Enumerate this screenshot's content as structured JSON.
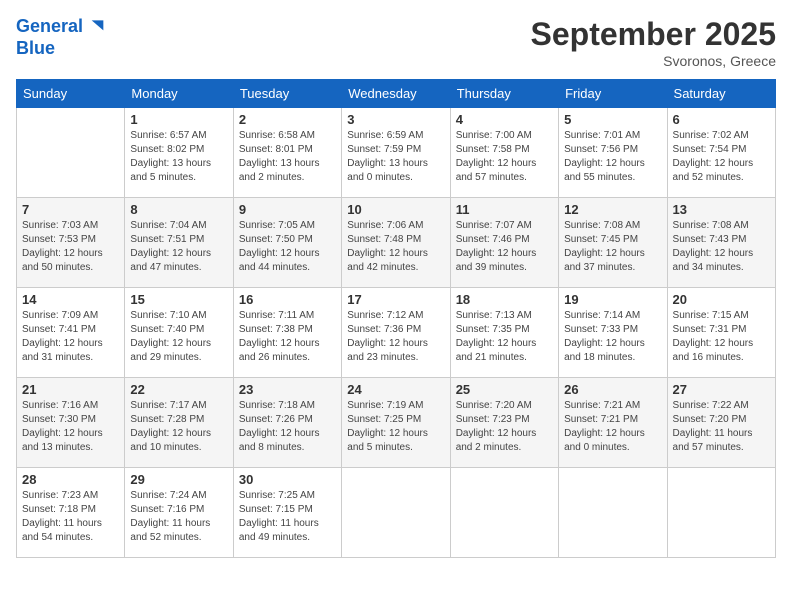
{
  "header": {
    "logo_line1": "General",
    "logo_line2": "Blue",
    "month": "September 2025",
    "location": "Svoronos, Greece"
  },
  "weekdays": [
    "Sunday",
    "Monday",
    "Tuesday",
    "Wednesday",
    "Thursday",
    "Friday",
    "Saturday"
  ],
  "weeks": [
    [
      {
        "day": "",
        "info": ""
      },
      {
        "day": "1",
        "info": "Sunrise: 6:57 AM\nSunset: 8:02 PM\nDaylight: 13 hours\nand 5 minutes."
      },
      {
        "day": "2",
        "info": "Sunrise: 6:58 AM\nSunset: 8:01 PM\nDaylight: 13 hours\nand 2 minutes."
      },
      {
        "day": "3",
        "info": "Sunrise: 6:59 AM\nSunset: 7:59 PM\nDaylight: 13 hours\nand 0 minutes."
      },
      {
        "day": "4",
        "info": "Sunrise: 7:00 AM\nSunset: 7:58 PM\nDaylight: 12 hours\nand 57 minutes."
      },
      {
        "day": "5",
        "info": "Sunrise: 7:01 AM\nSunset: 7:56 PM\nDaylight: 12 hours\nand 55 minutes."
      },
      {
        "day": "6",
        "info": "Sunrise: 7:02 AM\nSunset: 7:54 PM\nDaylight: 12 hours\nand 52 minutes."
      }
    ],
    [
      {
        "day": "7",
        "info": "Sunrise: 7:03 AM\nSunset: 7:53 PM\nDaylight: 12 hours\nand 50 minutes."
      },
      {
        "day": "8",
        "info": "Sunrise: 7:04 AM\nSunset: 7:51 PM\nDaylight: 12 hours\nand 47 minutes."
      },
      {
        "day": "9",
        "info": "Sunrise: 7:05 AM\nSunset: 7:50 PM\nDaylight: 12 hours\nand 44 minutes."
      },
      {
        "day": "10",
        "info": "Sunrise: 7:06 AM\nSunset: 7:48 PM\nDaylight: 12 hours\nand 42 minutes."
      },
      {
        "day": "11",
        "info": "Sunrise: 7:07 AM\nSunset: 7:46 PM\nDaylight: 12 hours\nand 39 minutes."
      },
      {
        "day": "12",
        "info": "Sunrise: 7:08 AM\nSunset: 7:45 PM\nDaylight: 12 hours\nand 37 minutes."
      },
      {
        "day": "13",
        "info": "Sunrise: 7:08 AM\nSunset: 7:43 PM\nDaylight: 12 hours\nand 34 minutes."
      }
    ],
    [
      {
        "day": "14",
        "info": "Sunrise: 7:09 AM\nSunset: 7:41 PM\nDaylight: 12 hours\nand 31 minutes."
      },
      {
        "day": "15",
        "info": "Sunrise: 7:10 AM\nSunset: 7:40 PM\nDaylight: 12 hours\nand 29 minutes."
      },
      {
        "day": "16",
        "info": "Sunrise: 7:11 AM\nSunset: 7:38 PM\nDaylight: 12 hours\nand 26 minutes."
      },
      {
        "day": "17",
        "info": "Sunrise: 7:12 AM\nSunset: 7:36 PM\nDaylight: 12 hours\nand 23 minutes."
      },
      {
        "day": "18",
        "info": "Sunrise: 7:13 AM\nSunset: 7:35 PM\nDaylight: 12 hours\nand 21 minutes."
      },
      {
        "day": "19",
        "info": "Sunrise: 7:14 AM\nSunset: 7:33 PM\nDaylight: 12 hours\nand 18 minutes."
      },
      {
        "day": "20",
        "info": "Sunrise: 7:15 AM\nSunset: 7:31 PM\nDaylight: 12 hours\nand 16 minutes."
      }
    ],
    [
      {
        "day": "21",
        "info": "Sunrise: 7:16 AM\nSunset: 7:30 PM\nDaylight: 12 hours\nand 13 minutes."
      },
      {
        "day": "22",
        "info": "Sunrise: 7:17 AM\nSunset: 7:28 PM\nDaylight: 12 hours\nand 10 minutes."
      },
      {
        "day": "23",
        "info": "Sunrise: 7:18 AM\nSunset: 7:26 PM\nDaylight: 12 hours\nand 8 minutes."
      },
      {
        "day": "24",
        "info": "Sunrise: 7:19 AM\nSunset: 7:25 PM\nDaylight: 12 hours\nand 5 minutes."
      },
      {
        "day": "25",
        "info": "Sunrise: 7:20 AM\nSunset: 7:23 PM\nDaylight: 12 hours\nand 2 minutes."
      },
      {
        "day": "26",
        "info": "Sunrise: 7:21 AM\nSunset: 7:21 PM\nDaylight: 12 hours\nand 0 minutes."
      },
      {
        "day": "27",
        "info": "Sunrise: 7:22 AM\nSunset: 7:20 PM\nDaylight: 11 hours\nand 57 minutes."
      }
    ],
    [
      {
        "day": "28",
        "info": "Sunrise: 7:23 AM\nSunset: 7:18 PM\nDaylight: 11 hours\nand 54 minutes."
      },
      {
        "day": "29",
        "info": "Sunrise: 7:24 AM\nSunset: 7:16 PM\nDaylight: 11 hours\nand 52 minutes."
      },
      {
        "day": "30",
        "info": "Sunrise: 7:25 AM\nSunset: 7:15 PM\nDaylight: 11 hours\nand 49 minutes."
      },
      {
        "day": "",
        "info": ""
      },
      {
        "day": "",
        "info": ""
      },
      {
        "day": "",
        "info": ""
      },
      {
        "day": "",
        "info": ""
      }
    ]
  ]
}
